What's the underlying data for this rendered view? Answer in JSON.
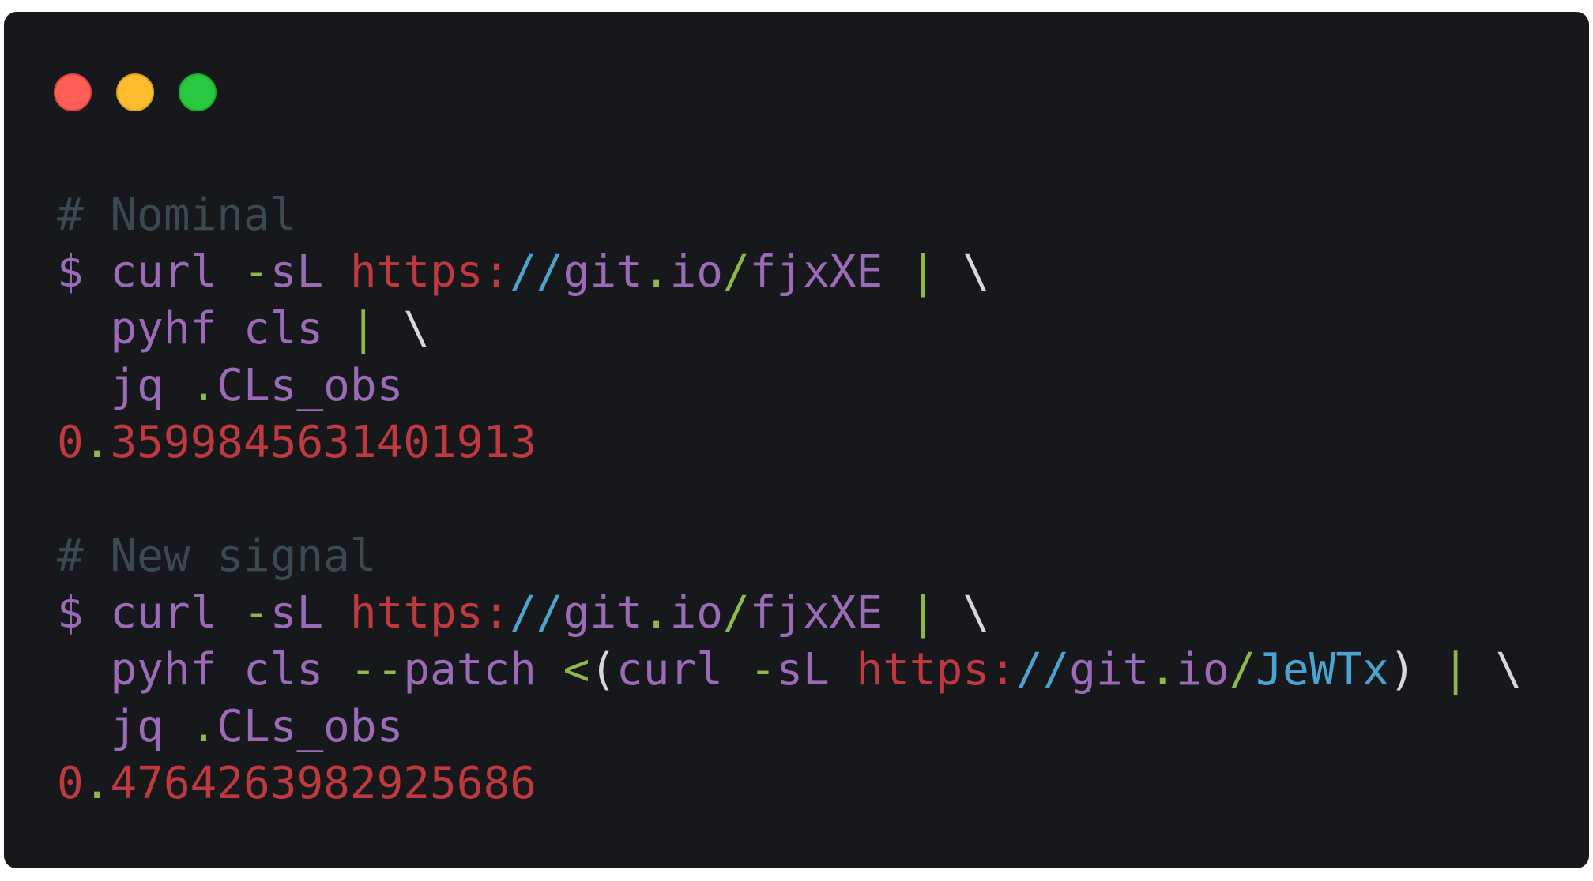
{
  "colors": {
    "window_bg": "#16181b",
    "comment": "#3b4a52",
    "purple": "#9b6ab8",
    "red": "#c0393f",
    "blue": "#4aa3d0",
    "green": "#8db84a",
    "white": "#d8d8d8"
  },
  "window_controls": [
    "close-icon",
    "minimize-icon",
    "zoom-icon"
  ],
  "terminal": {
    "lines": [
      {
        "name": "comment-nominal",
        "kind": "comment",
        "segments": [
          {
            "t": "# Nominal",
            "c": "#3b4a52"
          }
        ]
      },
      {
        "name": "command-line-1",
        "kind": "command",
        "segments": [
          {
            "t": "$ curl ",
            "c": "#9b6ab8"
          },
          {
            "t": "-",
            "c": "#8db84a"
          },
          {
            "t": "sL ",
            "c": "#9b6ab8"
          },
          {
            "t": "https:",
            "c": "#c0393f"
          },
          {
            "t": "//",
            "c": "#4aa3d0"
          },
          {
            "t": "git",
            "c": "#9b6ab8"
          },
          {
            "t": ".",
            "c": "#8db84a"
          },
          {
            "t": "io",
            "c": "#9b6ab8"
          },
          {
            "t": "/",
            "c": "#8db84a"
          },
          {
            "t": "fjxXE ",
            "c": "#9b6ab8"
          },
          {
            "t": "| ",
            "c": "#8db84a"
          },
          {
            "t": "\\",
            "c": "#d8d8d8"
          }
        ]
      },
      {
        "name": "command-line-2",
        "kind": "command",
        "segments": [
          {
            "t": "  pyhf cls ",
            "c": "#9b6ab8"
          },
          {
            "t": "| ",
            "c": "#8db84a"
          },
          {
            "t": "\\",
            "c": "#d8d8d8"
          }
        ]
      },
      {
        "name": "command-line-3",
        "kind": "command",
        "segments": [
          {
            "t": "  jq ",
            "c": "#9b6ab8"
          },
          {
            "t": ".",
            "c": "#8db84a"
          },
          {
            "t": "CLs_obs",
            "c": "#9b6ab8"
          }
        ]
      },
      {
        "name": "output-nominal",
        "kind": "output",
        "segments": [
          {
            "t": "0",
            "c": "#c0393f"
          },
          {
            "t": ".",
            "c": "#8db84a"
          },
          {
            "t": "3599845631401913",
            "c": "#c0393f"
          }
        ]
      },
      {
        "name": "blank-line",
        "kind": "blank",
        "segments": []
      },
      {
        "name": "comment-new-signal",
        "kind": "comment",
        "segments": [
          {
            "t": "# New signal",
            "c": "#3b4a52"
          }
        ]
      },
      {
        "name": "command-line-4",
        "kind": "command",
        "segments": [
          {
            "t": "$ curl ",
            "c": "#9b6ab8"
          },
          {
            "t": "-",
            "c": "#8db84a"
          },
          {
            "t": "sL ",
            "c": "#9b6ab8"
          },
          {
            "t": "https:",
            "c": "#c0393f"
          },
          {
            "t": "//",
            "c": "#4aa3d0"
          },
          {
            "t": "git",
            "c": "#9b6ab8"
          },
          {
            "t": ".",
            "c": "#8db84a"
          },
          {
            "t": "io",
            "c": "#9b6ab8"
          },
          {
            "t": "/",
            "c": "#8db84a"
          },
          {
            "t": "fjxXE ",
            "c": "#9b6ab8"
          },
          {
            "t": "| ",
            "c": "#8db84a"
          },
          {
            "t": "\\",
            "c": "#d8d8d8"
          }
        ]
      },
      {
        "name": "command-line-5",
        "kind": "command",
        "segments": [
          {
            "t": "  pyhf cls ",
            "c": "#9b6ab8"
          },
          {
            "t": "--",
            "c": "#8db84a"
          },
          {
            "t": "patch ",
            "c": "#9b6ab8"
          },
          {
            "t": "<",
            "c": "#8db84a"
          },
          {
            "t": "(",
            "c": "#d8d8d8"
          },
          {
            "t": "curl ",
            "c": "#9b6ab8"
          },
          {
            "t": "-",
            "c": "#8db84a"
          },
          {
            "t": "sL ",
            "c": "#9b6ab8"
          },
          {
            "t": "https:",
            "c": "#c0393f"
          },
          {
            "t": "//",
            "c": "#4aa3d0"
          },
          {
            "t": "git",
            "c": "#9b6ab8"
          },
          {
            "t": ".",
            "c": "#8db84a"
          },
          {
            "t": "io",
            "c": "#9b6ab8"
          },
          {
            "t": "/",
            "c": "#8db84a"
          },
          {
            "t": "JeWTx",
            "c": "#4aa3d0"
          },
          {
            "t": ") ",
            "c": "#d8d8d8"
          },
          {
            "t": "| ",
            "c": "#8db84a"
          },
          {
            "t": "\\",
            "c": "#d8d8d8"
          }
        ]
      },
      {
        "name": "command-line-6",
        "kind": "command",
        "segments": [
          {
            "t": "  jq ",
            "c": "#9b6ab8"
          },
          {
            "t": ".",
            "c": "#8db84a"
          },
          {
            "t": "CLs_obs",
            "c": "#9b6ab8"
          }
        ]
      },
      {
        "name": "output-new-signal",
        "kind": "output",
        "segments": [
          {
            "t": "0",
            "c": "#c0393f"
          },
          {
            "t": ".",
            "c": "#8db84a"
          },
          {
            "t": "4764263982925686",
            "c": "#c0393f"
          }
        ]
      }
    ]
  }
}
